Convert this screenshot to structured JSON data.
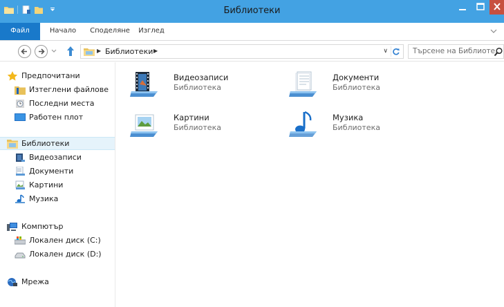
{
  "window": {
    "title": "Библиотеки",
    "accent": "#43a2e3",
    "close_color": "#c7503f"
  },
  "ribbon": {
    "tabs": [
      {
        "label": "Файл",
        "active": true
      },
      {
        "label": "Начало"
      },
      {
        "label": "Споделяне"
      },
      {
        "label": "Изглед"
      }
    ]
  },
  "address": {
    "path": "Библиотеки",
    "search_placeholder": "Търсене на Библиоте..."
  },
  "nav": {
    "favorites": {
      "label": "Предпочитани",
      "items": [
        "Изтеглени файлове",
        "Последни места",
        "Работен плот"
      ]
    },
    "libraries": {
      "label": "Библиотеки",
      "selected": true,
      "items": [
        "Видеозаписи",
        "Документи",
        "Картини",
        "Музика"
      ]
    },
    "computer": {
      "label": "Компютър",
      "items": [
        "Локален диск (C:)",
        "Локален диск (D:)"
      ]
    },
    "network": {
      "label": "Мрежа"
    }
  },
  "libraries": [
    {
      "name": "Видеозаписи",
      "type": "Библиотека",
      "icon": "video-library-icon"
    },
    {
      "name": "Документи",
      "type": "Библиотека",
      "icon": "documents-library-icon"
    },
    {
      "name": "Картини",
      "type": "Библиотека",
      "icon": "pictures-library-icon"
    },
    {
      "name": "Музика",
      "type": "Библиотека",
      "icon": "music-library-icon"
    }
  ]
}
